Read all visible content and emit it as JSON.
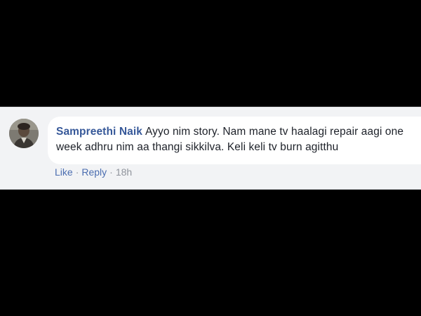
{
  "comment": {
    "author": "Sampreethi Naik",
    "text": "Ayyo nim story. Nam mane tv haalagi repair aagi one week adhru nim aa thangi sikkilva. Keli keli tv burn agitthu",
    "avatar_icon": "user-avatar-photo"
  },
  "actions": {
    "like_label": "Like",
    "separator": "·",
    "reply_label": "Reply",
    "timestamp": "18h"
  },
  "colors": {
    "background": "#000000",
    "strip": "#f2f3f5",
    "bubble": "#ffffff",
    "author": "#365899",
    "link": "#4b6db0",
    "muted": "#90949c",
    "text": "#1d2129"
  }
}
